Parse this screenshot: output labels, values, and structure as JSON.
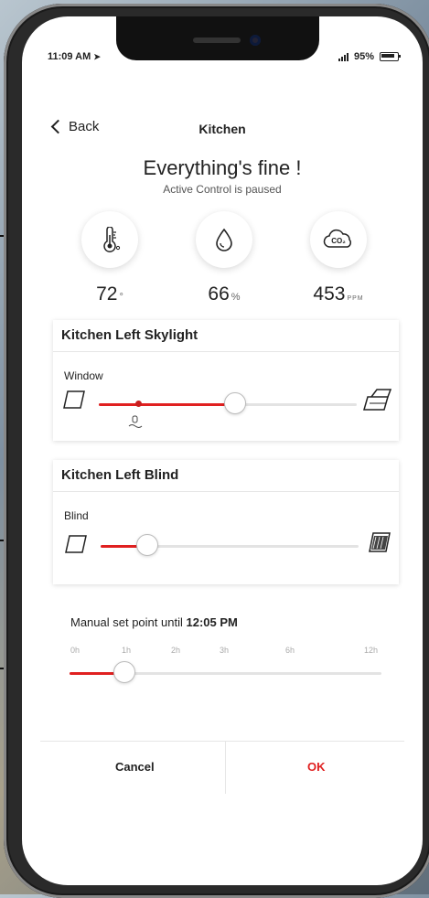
{
  "status_bar": {
    "time": "11:09 AM",
    "battery": "95%"
  },
  "nav": {
    "back_label": "Back",
    "title": "Kitchen"
  },
  "status": {
    "headline": "Everything's fine !",
    "subline": "Active Control is paused"
  },
  "sensors": {
    "temperature": {
      "value": "72",
      "unit": "°"
    },
    "humidity": {
      "value": "66",
      "unit": "%"
    },
    "co2": {
      "value": "453",
      "unit": "PPM",
      "icon_label": "CO₂"
    }
  },
  "skylight": {
    "title": "Kitchen Left Skylight",
    "label": "Window",
    "position_fraction": 0.53
  },
  "blind": {
    "title": "Kitchen Left Blind",
    "label": "Blind",
    "position_fraction": 0.18
  },
  "setpoint": {
    "label_prefix": "Manual set point until",
    "time": "12:05 PM",
    "ticks": [
      "0h",
      "1h",
      "2h",
      "3h",
      "6h",
      "12h"
    ],
    "selected": "1h"
  },
  "actions": {
    "cancel_label": "Cancel",
    "ok_label": "OK"
  },
  "colors": {
    "accent": "#e02020",
    "ok": "#e02020"
  }
}
